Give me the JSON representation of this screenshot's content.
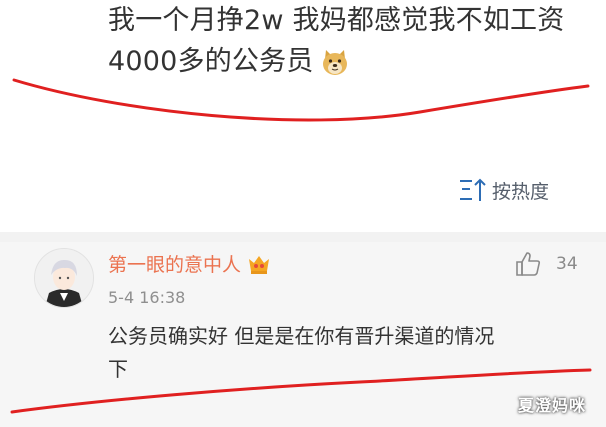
{
  "post": {
    "text_line1": "我一个月挣2w 我妈都感觉我不如工资",
    "text_line2": "4000多的公务员",
    "emoji": "doge-icon"
  },
  "sort": {
    "label": "按热度",
    "icon": "sort-arrow-icon"
  },
  "comment": {
    "author": "第一眼的意中人",
    "date": "5-4 16:38",
    "likes": "34",
    "text_line1": "公务员确实好 但是是在你有晋升渠道的情况",
    "text_line2": "下"
  },
  "watermark": "夏澄妈咪",
  "colors": {
    "author": "#eb7350",
    "annotation_line": "#e02020",
    "comment_bg": "#f6f6f6",
    "icon_blue": "#2d6db5"
  }
}
